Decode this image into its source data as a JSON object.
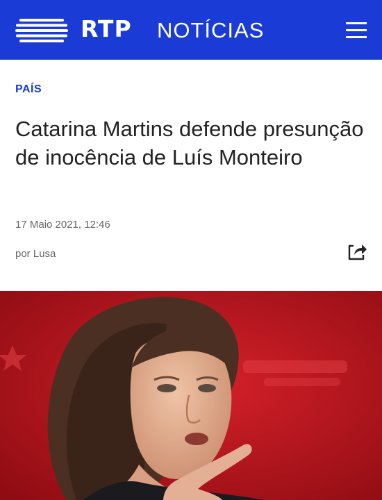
{
  "header": {
    "brand": "RTP",
    "section": "NOTÍCIAS",
    "logo_icon": "rtp-stripes-logo",
    "menu_icon": "hamburger-menu-icon"
  },
  "article": {
    "category": "PAÍS",
    "title": "Catarina Martins defende presunção de inocência de Luís Monteiro",
    "date": "17 Maio 2021, 12:46",
    "author": "por Lusa",
    "share_icon": "share-icon",
    "photo_description": "photo"
  },
  "colors": {
    "brand_blue": "#1a3bd6",
    "photo_background_red": "#b7121a"
  }
}
